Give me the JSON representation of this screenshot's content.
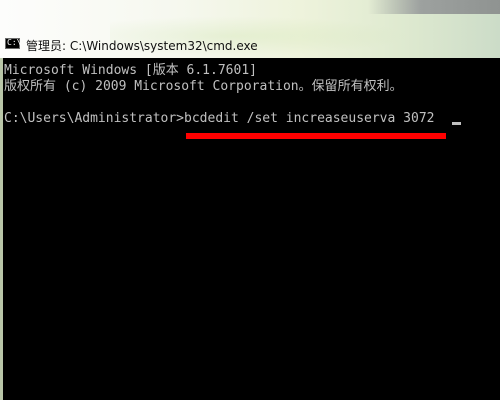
{
  "window": {
    "title": "管理员: C:\\Windows\\system32\\cmd.exe",
    "icon": "cmd-window-icon",
    "icon_glyph": "C:\\"
  },
  "console": {
    "lines": [
      "Microsoft Windows [版本 6.1.7601]",
      "版权所有 (c) 2009 Microsoft Corporation。保留所有权利。",
      "C:\\Users\\Administrator>bcdedit /set increaseuserva 3072"
    ],
    "highlight_color": "#ff0000",
    "text_color": "#c0c0c0",
    "background_color": "#000000"
  }
}
